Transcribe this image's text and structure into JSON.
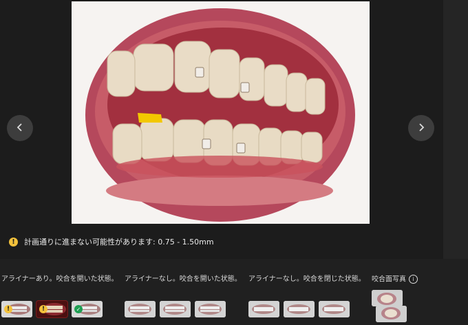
{
  "warning": {
    "icon": "warning-icon",
    "text": "計画通りに進まない可能性があります: 0.75 - 1.50mm"
  },
  "nav": {
    "prev_icon": "chevron-left-icon",
    "next_icon": "chevron-right-icon"
  },
  "groups": [
    {
      "label": "アライナーあり。咬合を開いた状態。",
      "thumbs": [
        {
          "badge": "warning"
        },
        {
          "badge": "warning",
          "selected": true
        },
        {
          "badge": "check"
        }
      ]
    },
    {
      "label": "アライナーなし。咬合を開いた状態。",
      "thumbs": [
        {},
        {},
        {}
      ]
    },
    {
      "label": "アライナーなし。咬合を閉じた状態。",
      "thumbs": [
        {},
        {},
        {}
      ]
    },
    {
      "label": "咬合面写真",
      "info_icon": "info-icon",
      "thumbs": [
        {},
        {}
      ]
    }
  ],
  "badges": {
    "warning": "!",
    "check": "✓"
  },
  "colors": {
    "warning": "#f3c23c",
    "success": "#1e9e52",
    "background": "#1e1e1e"
  }
}
